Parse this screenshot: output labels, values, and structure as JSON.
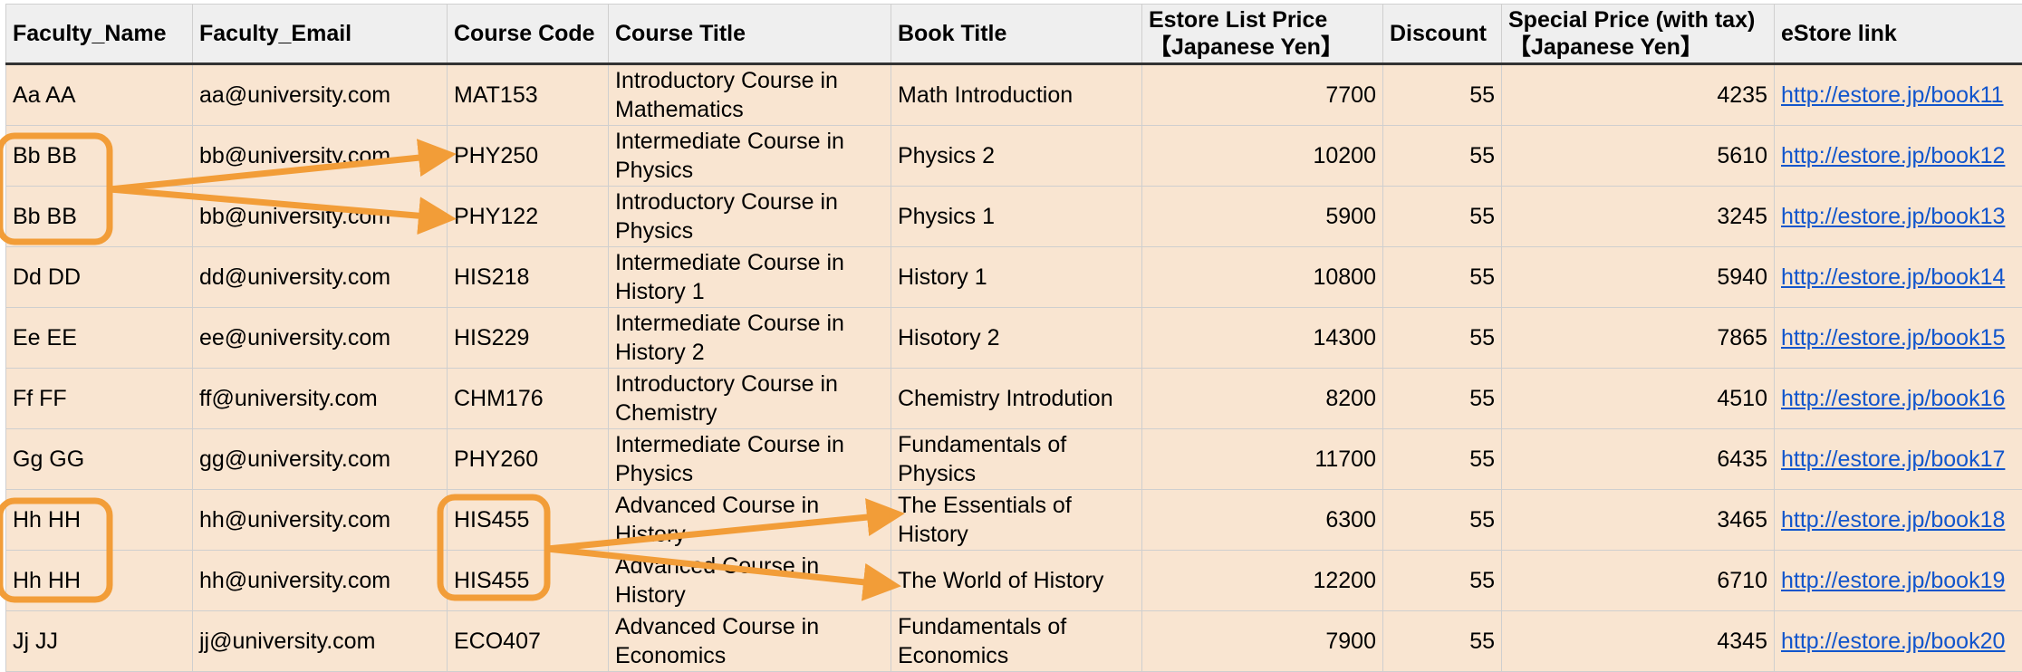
{
  "accent_color": "#f29d38",
  "link_color": "#1155cc",
  "row_fill": "#f9e5d1",
  "header_fill": "#efefef",
  "columns": [
    "Faculty_Name",
    "Faculty_Email",
    "Course Code",
    "Course Title",
    "Book Title",
    "Estore List Price 【Japanese Yen】",
    "Discount",
    "Special Price (with tax) 【Japanese Yen】",
    "eStore link"
  ],
  "rows": [
    [
      "Aa AA",
      "aa@university.com",
      "MAT153",
      "Introductory Course in Mathematics",
      "Math Introduction",
      "7700",
      "55",
      "4235",
      "http://estore.jp/book11"
    ],
    [
      "Bb BB",
      "bb@university.com",
      "PHY250",
      "Intermediate Course in Physics",
      "Physics 2",
      "10200",
      "55",
      "5610",
      "http://estore.jp/book12"
    ],
    [
      "Bb BB",
      "bb@university.com",
      "PHY122",
      "Introductory Course in Physics",
      "Physics 1",
      "5900",
      "55",
      "3245",
      "http://estore.jp/book13"
    ],
    [
      "Dd DD",
      "dd@university.com",
      "HIS218",
      "Intermediate Course in History 1",
      "History 1",
      "10800",
      "55",
      "5940",
      "http://estore.jp/book14"
    ],
    [
      "Ee EE",
      "ee@university.com",
      "HIS229",
      "Intermediate Course in History 2",
      "Hisotory 2",
      "14300",
      "55",
      "7865",
      "http://estore.jp/book15"
    ],
    [
      "Ff FF",
      "ff@university.com",
      "CHM176",
      "Introductory Course in Chemistry",
      "Chemistry Introdution",
      "8200",
      "55",
      "4510",
      "http://estore.jp/book16"
    ],
    [
      "Gg GG",
      "gg@university.com",
      "PHY260",
      "Intermediate Course in Physics",
      "Fundamentals of Physics",
      "11700",
      "55",
      "6435",
      "http://estore.jp/book17"
    ],
    [
      "Hh HH",
      "hh@university.com",
      "HIS455",
      "Advanced Course in History",
      "The Essentials of History",
      "6300",
      "55",
      "3465",
      "http://estore.jp/book18"
    ],
    [
      "Hh HH",
      "hh@university.com",
      "HIS455",
      "Advanced Course in History",
      "The World of History",
      "12200",
      "55",
      "6710",
      "http://estore.jp/book19"
    ],
    [
      "Jj JJ",
      "jj@university.com",
      "ECO407",
      "Advanced Course in Economics",
      "Fundamentals of Economics",
      "7900",
      "55",
      "4345",
      "http://estore.jp/book20"
    ]
  ],
  "annotations": [
    {
      "type": "highlight",
      "target": "Faculty_Name rows 2-3 (Bb BB)"
    },
    {
      "type": "arrow",
      "from": "Bb BB",
      "to": "PHY250"
    },
    {
      "type": "arrow",
      "from": "Bb BB",
      "to": "PHY122"
    },
    {
      "type": "highlight",
      "target": "Faculty_Name rows 8-9 (Hh HH)"
    },
    {
      "type": "highlight",
      "target": "Course Code rows 8-9 (HIS455)"
    },
    {
      "type": "arrow",
      "from": "HIS455",
      "to": "The Essentials of History"
    },
    {
      "type": "arrow",
      "from": "HIS455",
      "to": "The World of History"
    }
  ]
}
